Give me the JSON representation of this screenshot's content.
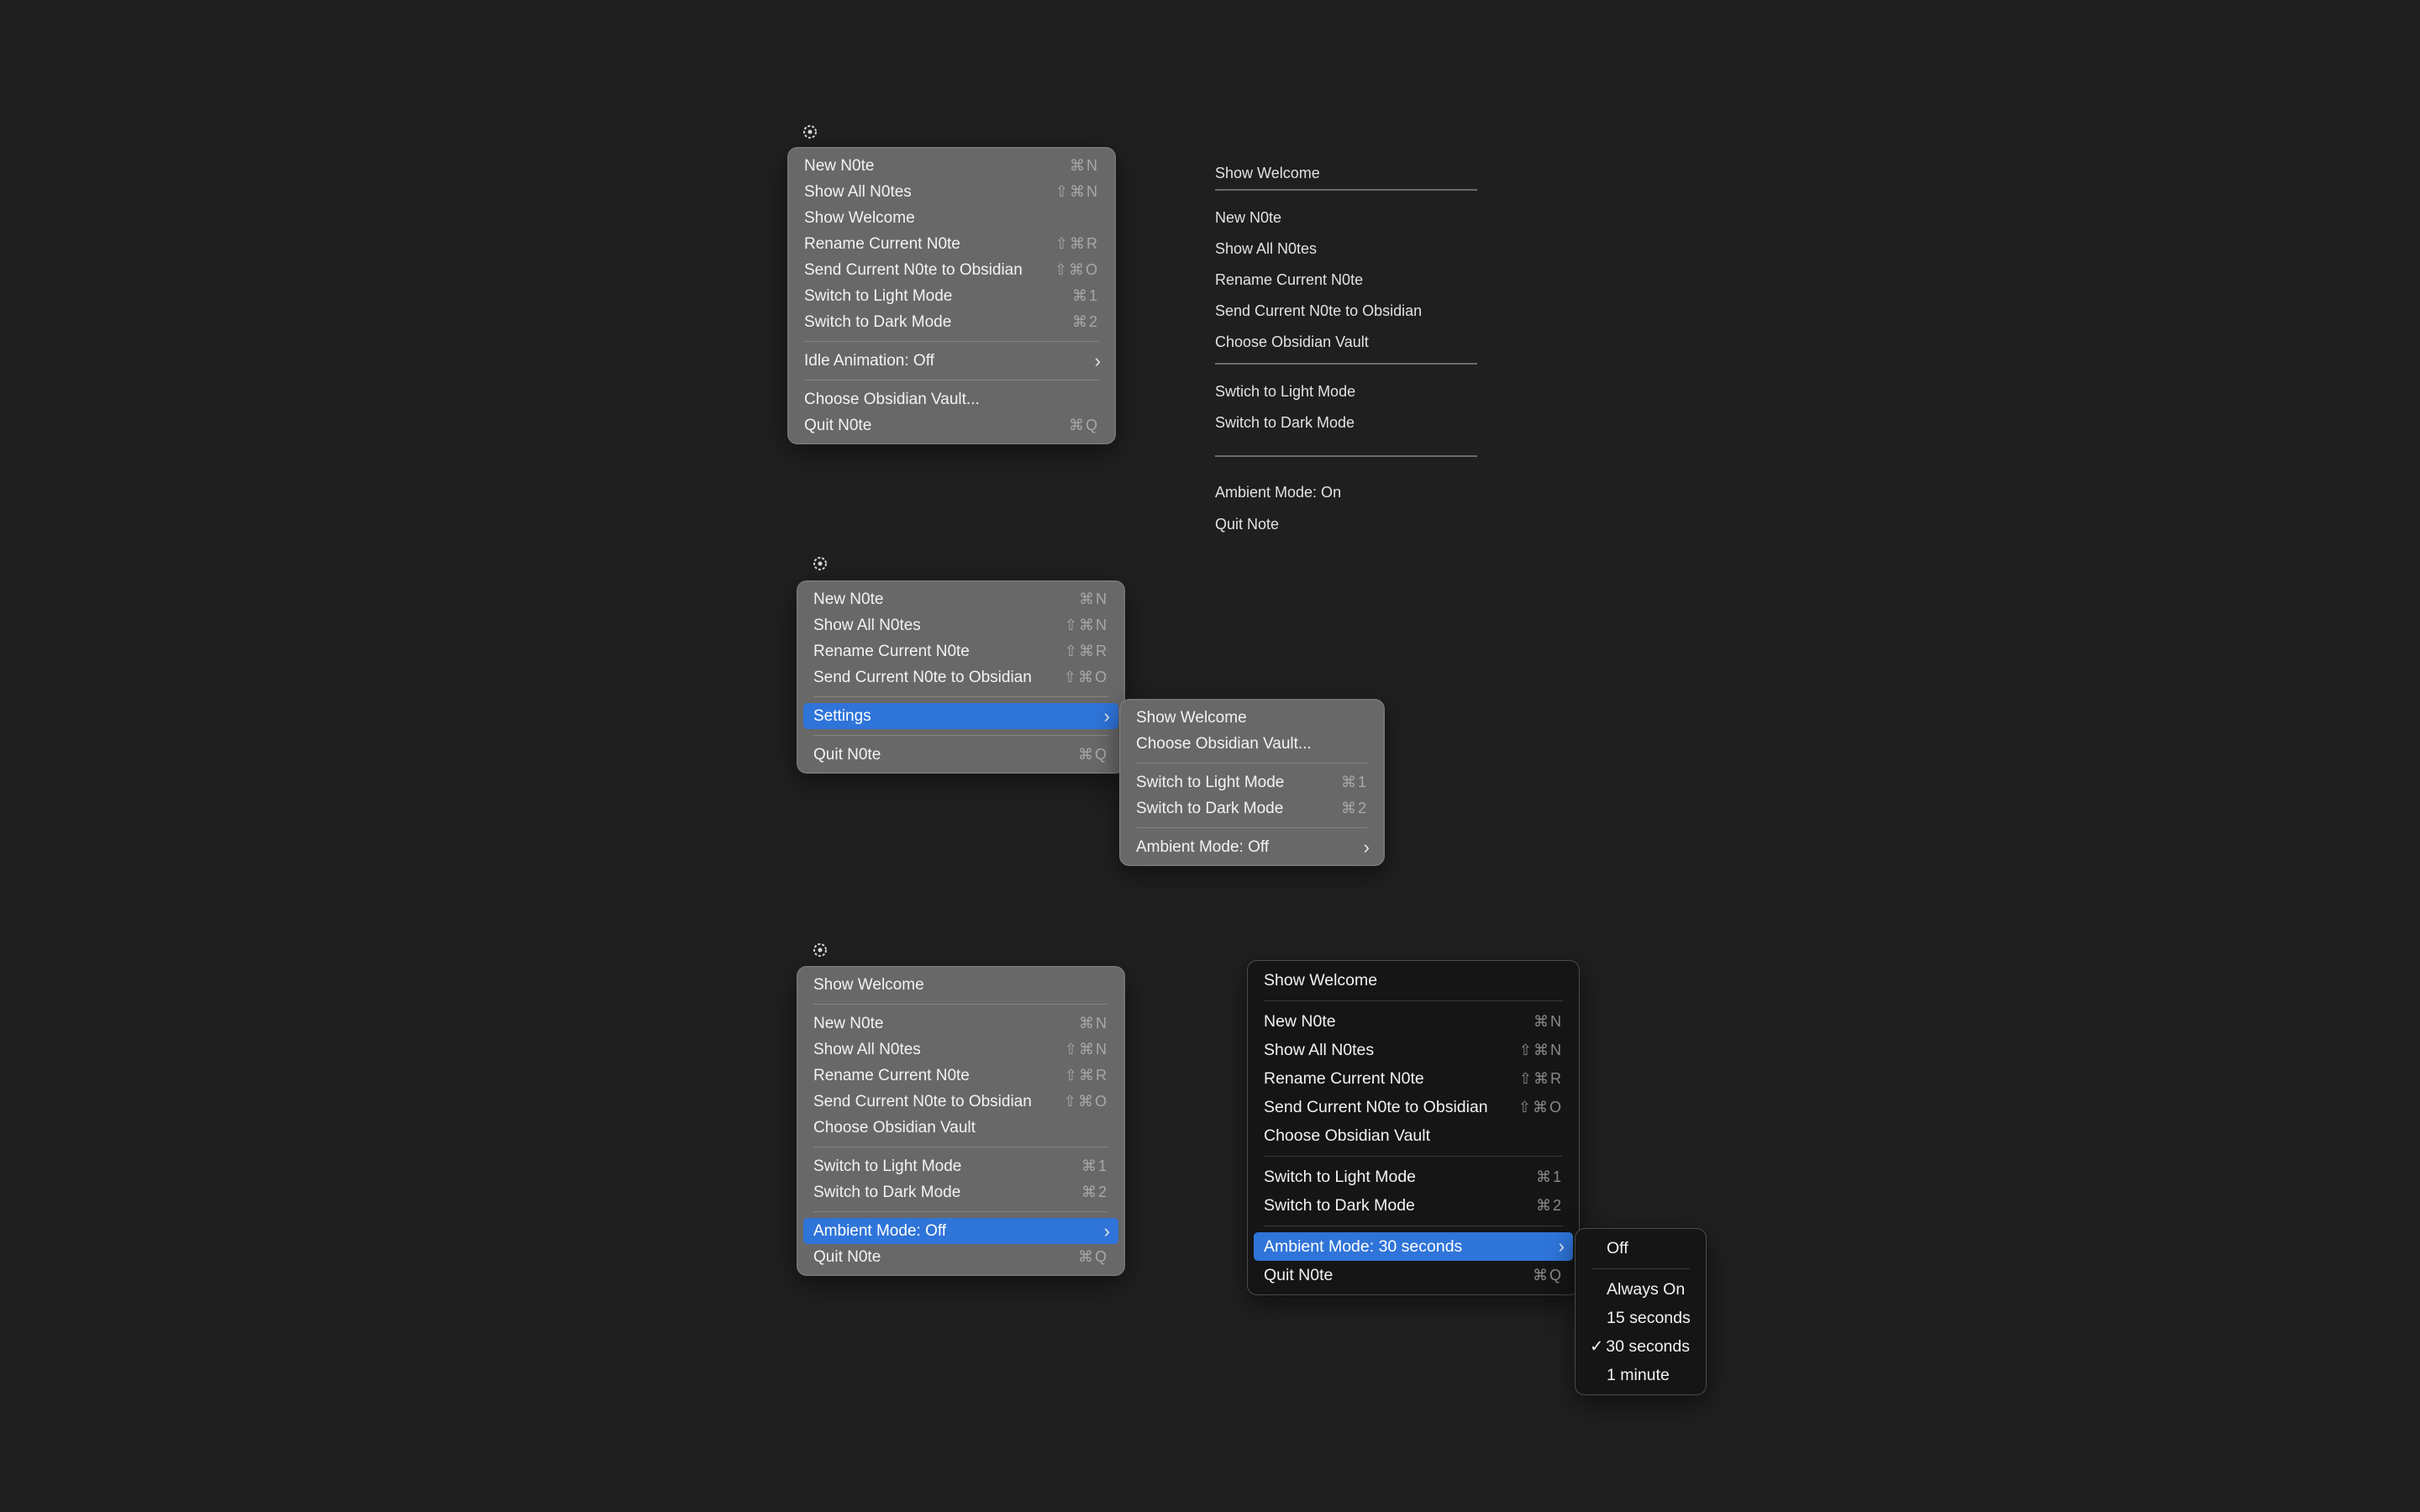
{
  "menu1": {
    "items": [
      {
        "label": "New N0te",
        "shortcut": "⌘N"
      },
      {
        "label": "Show All N0tes",
        "shortcut": "⇧⌘N"
      },
      {
        "label": "Show Welcome",
        "shortcut": ""
      },
      {
        "label": "Rename Current N0te",
        "shortcut": "⇧⌘R"
      },
      {
        "label": "Send Current N0te to Obsidian",
        "shortcut": "⇧⌘O"
      },
      {
        "label": "Switch to Light Mode",
        "shortcut": "⌘1"
      },
      {
        "label": "Switch to Dark Mode",
        "shortcut": "⌘2"
      }
    ],
    "idle_animation": "Idle Animation: Off",
    "choose_vault": "Choose Obsidian Vault...",
    "quit": {
      "label": "Quit N0te",
      "shortcut": "⌘Q"
    }
  },
  "plain_list": {
    "show_welcome": "Show Welcome",
    "group1": [
      "New N0te",
      "Show All N0tes",
      "Rename Current N0te",
      "Send Current N0te to Obsidian",
      "Choose Obsidian Vault"
    ],
    "group2": [
      "Swtich to Light Mode",
      "Switch to Dark Mode"
    ],
    "ambient": "Ambient Mode: On",
    "quit": "Quit Note"
  },
  "menu2": {
    "items": [
      {
        "label": "New N0te",
        "shortcut": "⌘N"
      },
      {
        "label": "Show All N0tes",
        "shortcut": "⇧⌘N"
      },
      {
        "label": "Rename Current N0te",
        "shortcut": "⇧⌘R"
      },
      {
        "label": "Send Current N0te to Obsidian",
        "shortcut": "⇧⌘O"
      }
    ],
    "settings": "Settings",
    "quit": {
      "label": "Quit N0te",
      "shortcut": "⌘Q"
    }
  },
  "settings_submenu": {
    "show_welcome": "Show Welcome",
    "choose_vault": "Choose Obsidian Vault...",
    "light": {
      "label": "Switch to Light Mode",
      "shortcut": "⌘1"
    },
    "dark": {
      "label": "Switch to Dark Mode",
      "shortcut": "⌘2"
    },
    "ambient": "Ambient Mode: Off"
  },
  "menu3": {
    "show_welcome": "Show Welcome",
    "items": [
      {
        "label": "New N0te",
        "shortcut": "⌘N"
      },
      {
        "label": "Show All N0tes",
        "shortcut": "⇧⌘N"
      },
      {
        "label": "Rename Current N0te",
        "shortcut": "⇧⌘R"
      },
      {
        "label": "Send Current N0te to Obsidian",
        "shortcut": "⇧⌘O"
      },
      {
        "label": "Choose Obsidian Vault",
        "shortcut": ""
      }
    ],
    "light": {
      "label": "Switch to Light Mode",
      "shortcut": "⌘1"
    },
    "dark": {
      "label": "Switch to Dark Mode",
      "shortcut": "⌘2"
    },
    "ambient": "Ambient Mode: Off",
    "quit": {
      "label": "Quit N0te",
      "shortcut": "⌘Q"
    }
  },
  "menu4": {
    "show_welcome": "Show Welcome",
    "items": [
      {
        "label": "New N0te",
        "shortcut": "⌘N"
      },
      {
        "label": "Show All N0tes",
        "shortcut": "⇧⌘N"
      },
      {
        "label": "Rename Current N0te",
        "shortcut": "⇧⌘R"
      },
      {
        "label": "Send Current N0te to Obsidian",
        "shortcut": "⇧⌘O"
      },
      {
        "label": "Choose Obsidian Vault",
        "shortcut": ""
      }
    ],
    "light": {
      "label": "Switch to Light Mode",
      "shortcut": "⌘1"
    },
    "dark": {
      "label": "Switch to Dark Mode",
      "shortcut": "⌘2"
    },
    "ambient": "Ambient Mode: 30 seconds",
    "quit": {
      "label": "Quit N0te",
      "shortcut": "⌘Q"
    }
  },
  "ambient_submenu": {
    "off": "Off",
    "options": [
      "Always On",
      "15 seconds",
      "30 seconds",
      "1 minute"
    ],
    "selected_index": 2,
    "check": "✓"
  },
  "colors": {
    "highlight": "#2f74d9",
    "background": "#1f1f1f",
    "menu_gray": "#686868",
    "menu_dark": "#151515"
  }
}
